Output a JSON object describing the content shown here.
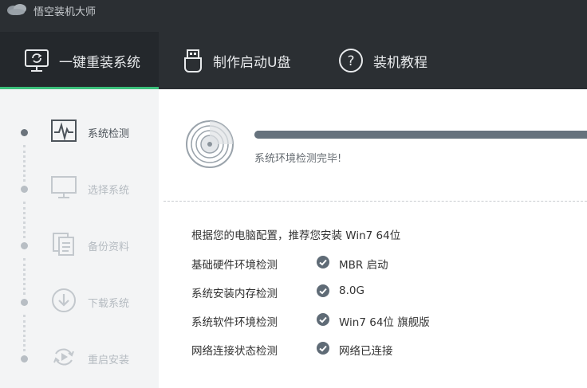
{
  "app": {
    "title": "悟空装机大师",
    "logo_icon": "cloud-logo-icon"
  },
  "nav": {
    "tabs": [
      {
        "label": "一键重装系统",
        "icon": "monitor-refresh-icon",
        "active": true
      },
      {
        "label": "制作启动U盘",
        "icon": "usb-drive-icon",
        "active": false
      },
      {
        "label": "装机教程",
        "icon": "help-circle-icon",
        "active": false
      }
    ],
    "accent_color": "#3bc07b"
  },
  "steps": [
    {
      "label": "系统检测",
      "icon": "pulse-monitor-icon",
      "state": "active"
    },
    {
      "label": "选择系统",
      "icon": "desktop-icon",
      "state": "inactive"
    },
    {
      "label": "备份资料",
      "icon": "documents-icon",
      "state": "inactive"
    },
    {
      "label": "下载系统",
      "icon": "download-icon",
      "state": "inactive"
    },
    {
      "label": "重启安装",
      "icon": "restart-icon",
      "state": "inactive"
    }
  ],
  "detection": {
    "progress": 1.0,
    "status_text": "系统环境检测完毕!",
    "recommendation": "根据您的电脑配置，推荐您安装 Win7 64位",
    "checks": [
      {
        "name": "基础硬件环境检测",
        "value": "MBR 启动"
      },
      {
        "name": "系统安装内存检测",
        "value": "8.0G"
      },
      {
        "name": "系统软件环境检测",
        "value": "Win7 64位 旗舰版"
      },
      {
        "name": "网络连接状态检测",
        "value": "网络已连接"
      }
    ]
  }
}
